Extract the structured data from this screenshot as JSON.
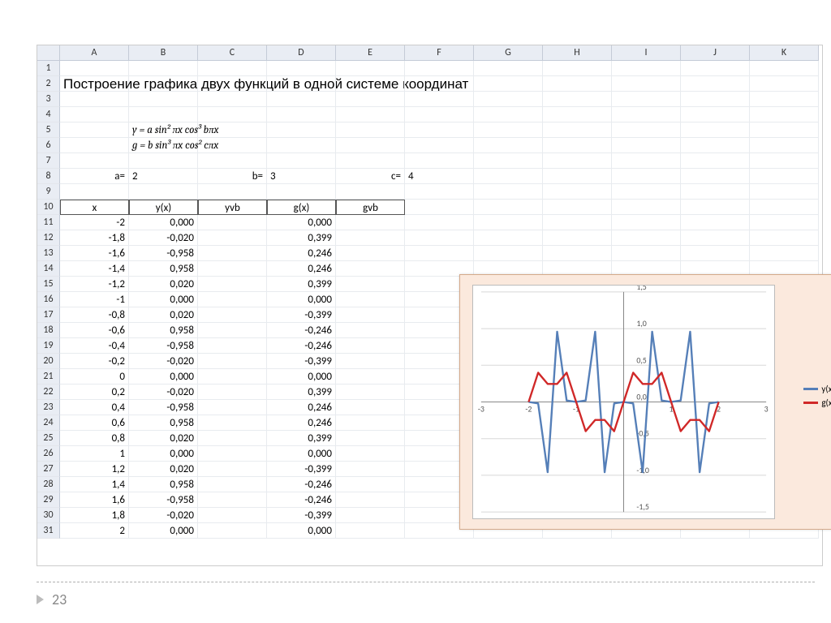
{
  "columns": [
    "A",
    "B",
    "C",
    "D",
    "E",
    "F",
    "G",
    "H",
    "I",
    "J",
    "K"
  ],
  "title": "Построение графика двух функций в одной системе координат",
  "formula1": "y = a sin² πx cos³ bπx",
  "formula2": "g = b sin³ πx cos² cπx",
  "params": {
    "a_lbl": "a=",
    "a_val": "2",
    "b_lbl": "b=",
    "b_val": "3",
    "c_lbl": "c=",
    "c_val": "4"
  },
  "table_hdr": {
    "x": "x",
    "y": "y(x)",
    "yvb": "yvb",
    "g": "g(x)",
    "gvb": "gvb"
  },
  "rows": [
    {
      "n": "11",
      "x": "-2",
      "y": "0,000",
      "g": "0,000"
    },
    {
      "n": "12",
      "x": "-1,8",
      "y": "-0,020",
      "g": "0,399"
    },
    {
      "n": "13",
      "x": "-1,6",
      "y": "-0,958",
      "g": "0,246"
    },
    {
      "n": "14",
      "x": "-1,4",
      "y": "0,958",
      "g": "0,246"
    },
    {
      "n": "15",
      "x": "-1,2",
      "y": "0,020",
      "g": "0,399"
    },
    {
      "n": "16",
      "x": "-1",
      "y": "0,000",
      "g": "0,000"
    },
    {
      "n": "17",
      "x": "-0,8",
      "y": "0,020",
      "g": "-0,399"
    },
    {
      "n": "18",
      "x": "-0,6",
      "y": "0,958",
      "g": "-0,246"
    },
    {
      "n": "19",
      "x": "-0,4",
      "y": "-0,958",
      "g": "-0,246"
    },
    {
      "n": "20",
      "x": "-0,2",
      "y": "-0,020",
      "g": "-0,399"
    },
    {
      "n": "21",
      "x": "0",
      "y": "0,000",
      "g": "0,000"
    },
    {
      "n": "22",
      "x": "0,2",
      "y": "-0,020",
      "g": "0,399"
    },
    {
      "n": "23",
      "x": "0,4",
      "y": "-0,958",
      "g": "0,246"
    },
    {
      "n": "24",
      "x": "0,6",
      "y": "0,958",
      "g": "0,246"
    },
    {
      "n": "25",
      "x": "0,8",
      "y": "0,020",
      "g": "0,399"
    },
    {
      "n": "26",
      "x": "1",
      "y": "0,000",
      "g": "0,000"
    },
    {
      "n": "27",
      "x": "1,2",
      "y": "0,020",
      "g": "-0,399"
    },
    {
      "n": "28",
      "x": "1,4",
      "y": "0,958",
      "g": "-0,246"
    },
    {
      "n": "29",
      "x": "1,6",
      "y": "-0,958",
      "g": "-0,246"
    },
    {
      "n": "30",
      "x": "1,8",
      "y": "-0,020",
      "g": "-0,399"
    },
    {
      "n": "31",
      "x": "2",
      "y": "0,000",
      "g": "0,000"
    }
  ],
  "page_number": "23",
  "chart_data": {
    "type": "line",
    "xlim": [
      -3,
      3
    ],
    "ylim": [
      -1.5,
      1.5
    ],
    "xticks": [
      -3,
      -2,
      -1,
      0,
      1,
      2,
      3
    ],
    "yticks": [
      -1.5,
      -1.0,
      -0.5,
      0.0,
      0.5,
      1.0,
      1.5
    ],
    "ytick_labels": [
      "-1,5",
      "-1,0",
      "-0,5",
      "0,0",
      "0,5",
      "1,0",
      "1,5"
    ],
    "legend_pos": "right",
    "colors": {
      "y": "#557fb8",
      "g": "#d02828"
    },
    "series": [
      {
        "name": "y(x)",
        "x": [
          -2,
          -1.8,
          -1.6,
          -1.4,
          -1.2,
          -1,
          -0.8,
          -0.6,
          -0.4,
          -0.2,
          0,
          0.2,
          0.4,
          0.6,
          0.8,
          1,
          1.2,
          1.4,
          1.6,
          1.8,
          2
        ],
        "values": [
          0,
          -0.02,
          -0.958,
          0.958,
          0.02,
          0,
          0.02,
          0.958,
          -0.958,
          -0.02,
          0,
          -0.02,
          -0.958,
          0.958,
          0.02,
          0,
          0.02,
          0.958,
          -0.958,
          -0.02,
          0
        ]
      },
      {
        "name": "g(x)",
        "x": [
          -2,
          -1.8,
          -1.6,
          -1.4,
          -1.2,
          -1,
          -0.8,
          -0.6,
          -0.4,
          -0.2,
          0,
          0.2,
          0.4,
          0.6,
          0.8,
          1,
          1.2,
          1.4,
          1.6,
          1.8,
          2
        ],
        "values": [
          0,
          0.399,
          0.246,
          0.246,
          0.399,
          0,
          -0.399,
          -0.246,
          -0.246,
          -0.399,
          0,
          0.399,
          0.246,
          0.246,
          0.399,
          0,
          -0.399,
          -0.246,
          -0.246,
          -0.399,
          0
        ]
      }
    ]
  }
}
